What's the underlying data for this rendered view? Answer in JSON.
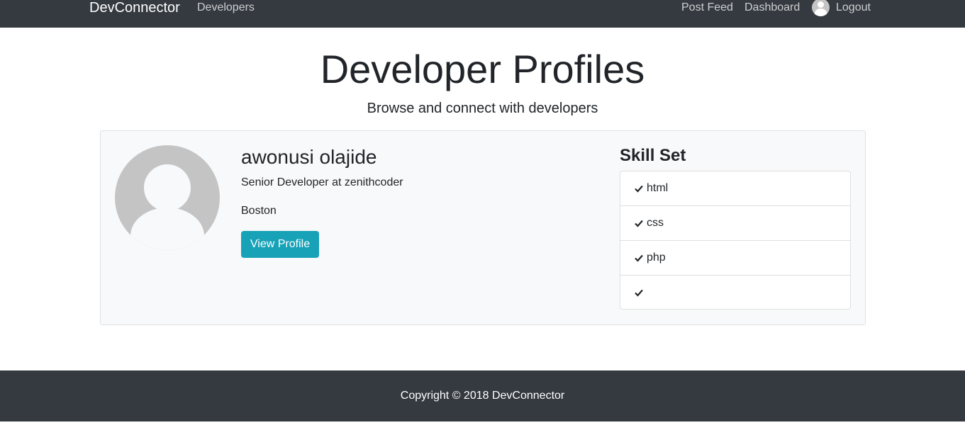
{
  "navbar": {
    "brand": "DevConnector",
    "left_links": [
      "Developers"
    ],
    "right_links": {
      "post_feed": "Post Feed",
      "dashboard": "Dashboard",
      "logout": "Logout"
    }
  },
  "header": {
    "title": "Developer Profiles",
    "lead": "Browse and connect with developers"
  },
  "profile": {
    "name": "awonusi olajide",
    "status": "Senior Developer at zenithcoder",
    "location": "Boston",
    "view_button": "View Profile",
    "skills_title": "Skill Set",
    "skills": [
      "html",
      "css",
      "php",
      ""
    ]
  },
  "footer": {
    "text": "Copyright © 2018 DevConnector"
  },
  "colors": {
    "navbar_bg": "#343a40",
    "button_bg": "#17a2b8",
    "card_bg": "#f8f9fa"
  }
}
